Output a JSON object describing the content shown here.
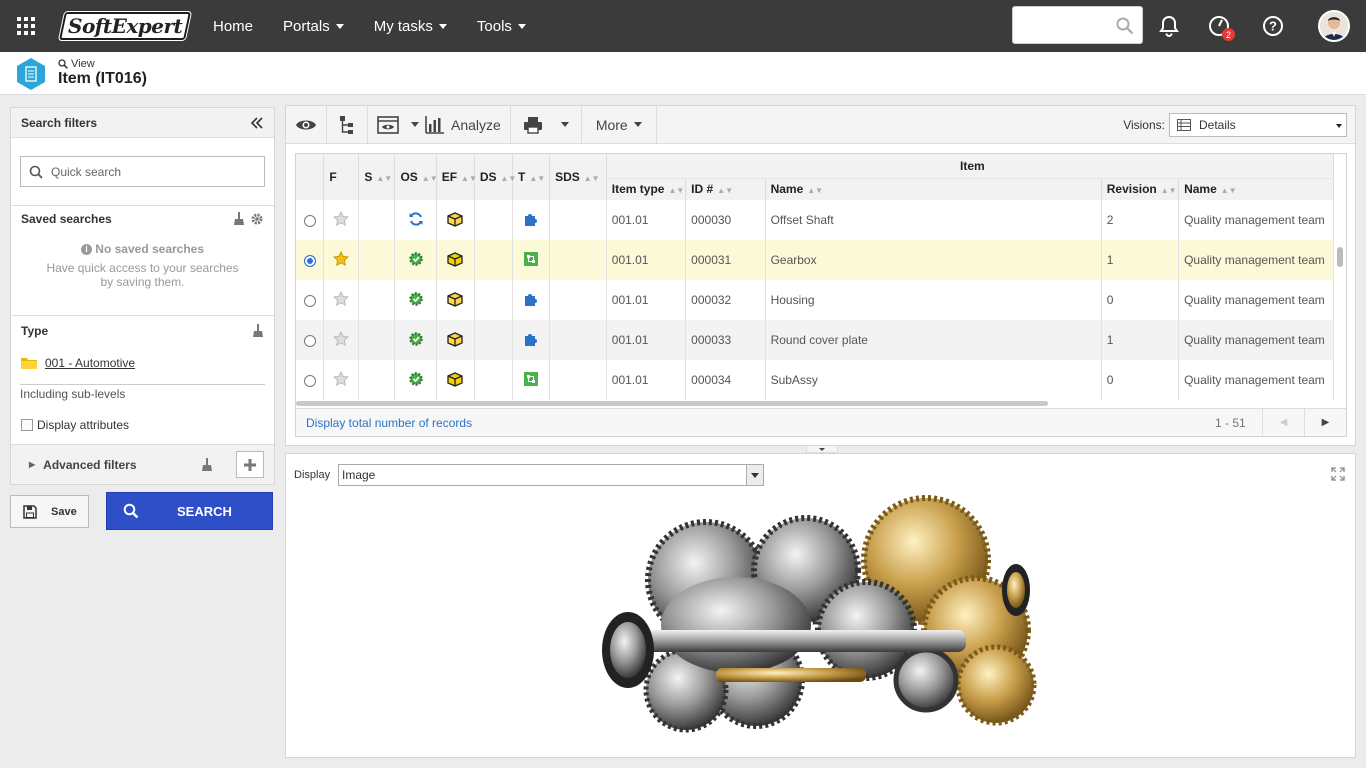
{
  "topbar": {
    "logo_text": "SoftExpert",
    "nav": [
      {
        "label": "Home",
        "dropdown": false
      },
      {
        "label": "Portals",
        "dropdown": true
      },
      {
        "label": "My tasks",
        "dropdown": true
      },
      {
        "label": "Tools",
        "dropdown": true
      }
    ],
    "search_placeholder": "",
    "tasks_badge": "2"
  },
  "subheader": {
    "view_label": "View",
    "title": "Item (IT016)"
  },
  "filters": {
    "title": "Search filters",
    "quick_search_placeholder": "Quick search",
    "saved_title": "Saved searches",
    "no_saved": "No saved searches",
    "no_saved_desc": "Have quick access to your searches by saving them.",
    "type_title": "Type",
    "type_value": "001 - Automotive",
    "sublevels": "Including sub-levels",
    "display_attributes": "Display attributes",
    "advanced": "Advanced filters",
    "save_label": "Save",
    "search_label": "SEARCH"
  },
  "toolbar": {
    "analyze": "Analyze",
    "more": "More",
    "visions_label": "Visions:",
    "visions_value": "Details"
  },
  "grid": {
    "group_header": "Item",
    "columns": {
      "f": "F",
      "s": "S",
      "os": "OS",
      "ef": "EF",
      "ds": "DS",
      "t": "T",
      "sds": "SDS",
      "item_type": "Item type",
      "id": "ID #",
      "name": "Name",
      "revision": "Revision",
      "name2": "Name"
    },
    "rows": [
      {
        "selected": false,
        "fav": false,
        "os": "sync",
        "ef": "yellow",
        "t": "puzzle",
        "item_type": "001.01",
        "id": "000030",
        "name": "Offset Shaft",
        "revision": "2",
        "team": "Quality management team"
      },
      {
        "selected": true,
        "fav": true,
        "os": "gear",
        "ef": "yellow-dark",
        "t": "green-box",
        "item_type": "001.01",
        "id": "000031",
        "name": "Gearbox",
        "revision": "1",
        "team": "Quality management team"
      },
      {
        "selected": false,
        "fav": false,
        "os": "gear",
        "ef": "yellow",
        "t": "puzzle",
        "item_type": "001.01",
        "id": "000032",
        "name": "Housing",
        "revision": "0",
        "team": "Quality management team"
      },
      {
        "selected": false,
        "fav": false,
        "os": "gear",
        "ef": "yellow",
        "t": "puzzle",
        "item_type": "001.01",
        "id": "000033",
        "name": "Round cover plate",
        "revision": "1",
        "team": "Quality management team"
      },
      {
        "selected": false,
        "fav": false,
        "os": "gear",
        "ef": "yellow-dark",
        "t": "green-box",
        "item_type": "001.01",
        "id": "000034",
        "name": "SubAssy",
        "revision": "0",
        "team": "Quality management team"
      }
    ],
    "total_link": "Display total number of records",
    "paging": "1 - 51"
  },
  "preview": {
    "display_label": "Display",
    "display_value": "Image"
  },
  "colors": {
    "topbar": "#3b3b3b",
    "primary_button": "#2f4fc8",
    "selected_row": "#fcf9d8",
    "link": "#2a73c8"
  }
}
